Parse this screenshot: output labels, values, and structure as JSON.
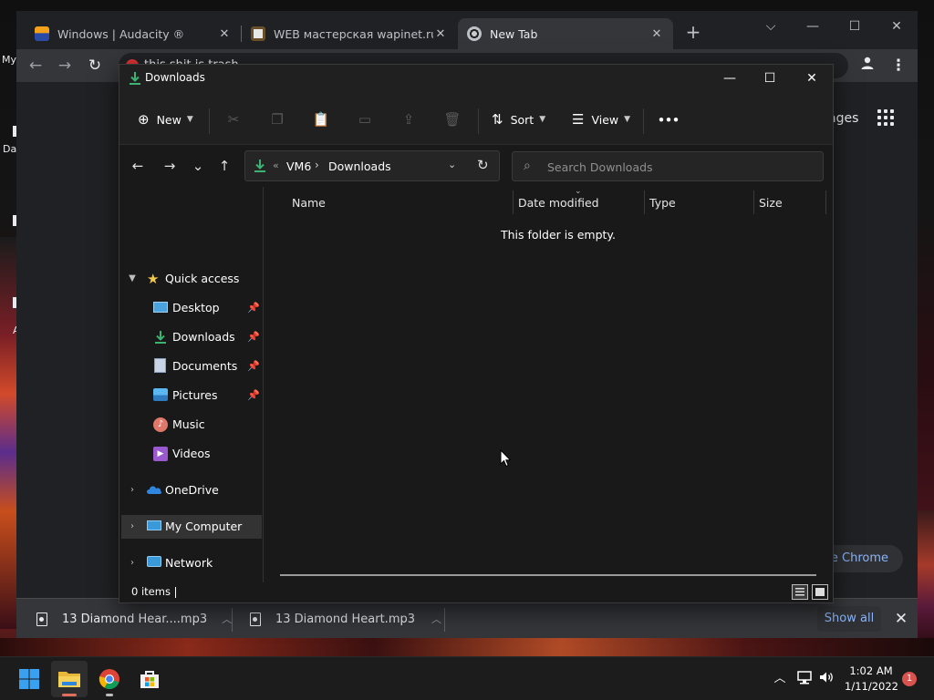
{
  "desktop": {
    "fragment_top": "My",
    "fragment_mid": "Da",
    "fragment_low": "A"
  },
  "chrome": {
    "tabs": [
      {
        "title": "Windows | Audacity ®",
        "icon": "audacity-icon"
      },
      {
        "title": "WEB мастерская wapinet.ru - 13",
        "icon": "wapinet-icon"
      },
      {
        "title": "New Tab",
        "icon": "chrome-icon"
      }
    ],
    "tab_close": "✕",
    "new_tab": "+",
    "window_controls": {
      "minimize": "⌵",
      "restore": "—",
      "maximize": "☐",
      "close": "✕"
    },
    "nav": {
      "back": "←",
      "forward": "→",
      "reload": "↻"
    },
    "omnibox_text": "this shit is trash",
    "ntp_images": "ages",
    "customize_label": "ze Chrome",
    "menu": "⋮"
  },
  "downloads_bar": {
    "items": [
      {
        "name": "13 Diamond Hear....mp3"
      },
      {
        "name": "13 Diamond Heart.mp3"
      }
    ],
    "chevron": "︿",
    "show_all": "Show all",
    "close": "✕"
  },
  "explorer": {
    "title": "Downloads",
    "window_controls": {
      "minimize": "—",
      "maximize": "☐",
      "close": "✕"
    },
    "commands": {
      "new": "New",
      "sort": "Sort",
      "view": "View",
      "more": "•••"
    },
    "nav": {
      "back": "←",
      "forward": "→",
      "recent": "⌄",
      "up": "↑"
    },
    "address": {
      "chevrons": "«",
      "segment1": "VM6",
      "separator": "›",
      "segment2": "Downloads",
      "dropdown": "⌄",
      "refresh": "↻"
    },
    "search_placeholder": "Search Downloads",
    "navpane": {
      "quick_access": "Quick access",
      "quick_items": [
        {
          "label": "Desktop",
          "icon": "desktop-folder-icon",
          "pinned": true
        },
        {
          "label": "Downloads",
          "icon": "downloads-folder-icon",
          "pinned": true
        },
        {
          "label": "Documents",
          "icon": "documents-folder-icon",
          "pinned": true
        },
        {
          "label": "Pictures",
          "icon": "pictures-folder-icon",
          "pinned": true
        },
        {
          "label": "Music",
          "icon": "music-folder-icon",
          "pinned": false
        },
        {
          "label": "Videos",
          "icon": "videos-folder-icon",
          "pinned": false
        }
      ],
      "onedrive": "OneDrive",
      "my_computer": "My Computer",
      "network": "Network",
      "pin_glyph": "📌"
    },
    "columns": [
      "Name",
      "Date modified",
      "Type",
      "Size"
    ],
    "empty_message": "This folder is empty.",
    "status_count": "0 items"
  },
  "taskbar": {
    "apps": [
      {
        "name": "Start",
        "icon": "windows-start-icon"
      },
      {
        "name": "File Explorer",
        "icon": "file-explorer-icon",
        "active": true
      },
      {
        "name": "Google Chrome",
        "icon": "chrome-icon",
        "running": true
      },
      {
        "name": "Microsoft Store",
        "icon": "store-icon"
      }
    ],
    "tray": {
      "chevron": "︿"
    },
    "time": "1:02 AM",
    "date": "1/11/2022",
    "notification_count": "1"
  },
  "colors": {
    "accent_green": "#3cb371",
    "link_blue": "#8ab4f8",
    "badge_red": "#d9534f"
  }
}
